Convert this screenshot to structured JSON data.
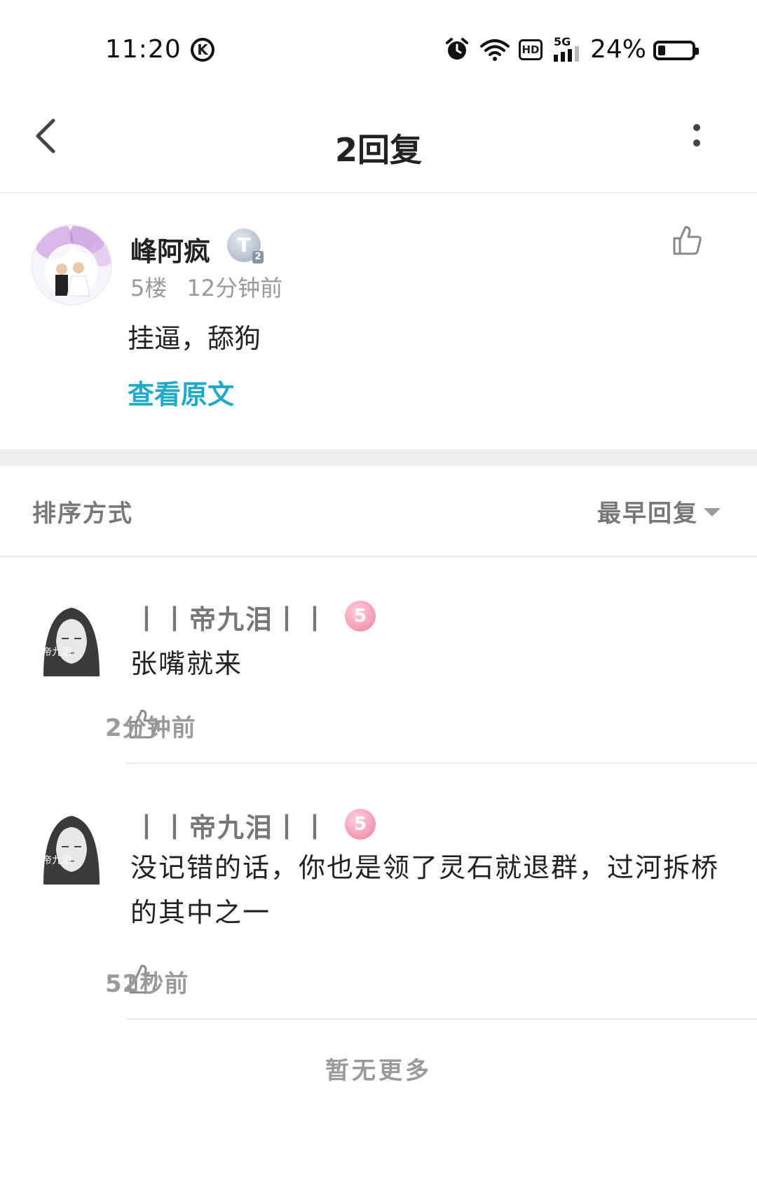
{
  "status_bar": {
    "time": "11:20",
    "k_badge": "K",
    "network": "5G",
    "hd": "HD",
    "battery": "24%"
  },
  "header": {
    "title": "2回复"
  },
  "post": {
    "author": "峰阿疯",
    "badge": "T",
    "badge_level": "2",
    "floor": "5楼",
    "time": "12分钟前",
    "content": "挂逼，舔狗",
    "view_original": "查看原文"
  },
  "sort": {
    "label": "排序方式",
    "value": "最早回复"
  },
  "replies": [
    {
      "author": "丨丨帝九泪丨丨",
      "level": "5",
      "content": "张嘴就来",
      "time": "2分钟前"
    },
    {
      "author": "丨丨帝九泪丨丨",
      "level": "5",
      "content": "没记错的话，你也是领了灵石就退群，过河拆桥的其中之一",
      "time": "52秒前"
    }
  ],
  "footer": {
    "no_more": "暂无更多"
  }
}
